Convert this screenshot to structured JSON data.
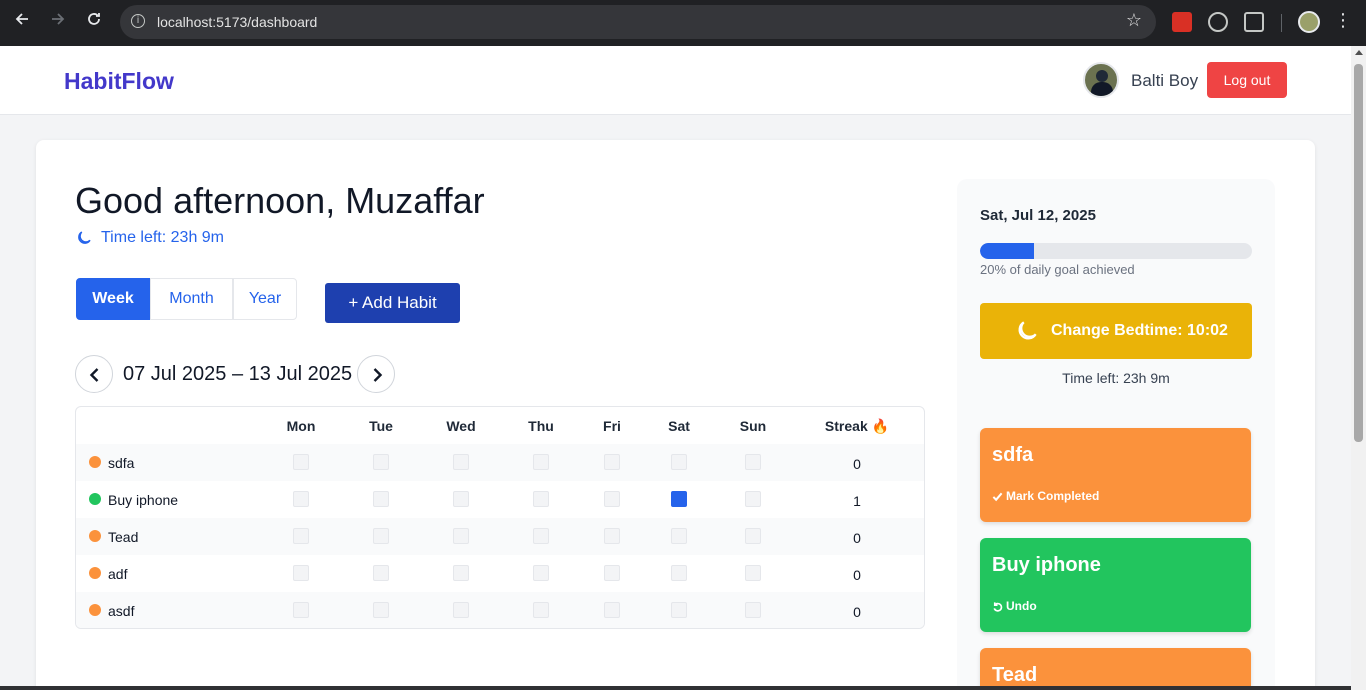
{
  "browser": {
    "url": "localhost:5173/dashboard",
    "info_glyph": "i",
    "star_glyph": "☆",
    "menu_glyph": "⋮"
  },
  "header": {
    "brand": "HabitFlow",
    "user_name": "Balti Boy",
    "logout_label": "Log out"
  },
  "main": {
    "greeting": "Good afternoon, Muzaffar",
    "time_left": "Time left: 23h 9m",
    "view_tabs": [
      {
        "label": "Week",
        "active": true
      },
      {
        "label": "Month",
        "active": false
      },
      {
        "label": "Year",
        "active": false
      }
    ],
    "add_habit_label": "+ Add Habit",
    "date_range": "07 Jul 2025 – 13 Jul 2025",
    "table": {
      "headers": [
        "Mon",
        "Tue",
        "Wed",
        "Thu",
        "Fri",
        "Sat",
        "Sun",
        "Streak 🔥"
      ],
      "rows": [
        {
          "name": "sdfa",
          "color": "#fb923c",
          "days": [
            false,
            false,
            false,
            false,
            false,
            false,
            false
          ],
          "streak": "0"
        },
        {
          "name": "Buy iphone",
          "color": "#22c55e",
          "days": [
            false,
            false,
            false,
            false,
            false,
            true,
            false
          ],
          "streak": "1"
        },
        {
          "name": "Tead",
          "color": "#fb923c",
          "days": [
            false,
            false,
            false,
            false,
            false,
            false,
            false
          ],
          "streak": "0"
        },
        {
          "name": "adf",
          "color": "#fb923c",
          "days": [
            false,
            false,
            false,
            false,
            false,
            false,
            false
          ],
          "streak": "0"
        },
        {
          "name": "asdf",
          "color": "#fb923c",
          "days": [
            false,
            false,
            false,
            false,
            false,
            false,
            false
          ],
          "streak": "0"
        }
      ]
    }
  },
  "side": {
    "date": "Sat, Jul 12, 2025",
    "progress_fraction": 0.2,
    "progress_text": "20% of daily goal achieved",
    "bedtime_label": "Change Bedtime: 10:02",
    "time_left": "Time left: 23h 9m",
    "cards": [
      {
        "title": "sdfa",
        "action": "Mark Completed",
        "color": "#fb923c",
        "icon": "check-icon"
      },
      {
        "title": "Buy iphone",
        "action": "Undo",
        "color": "#22c55e",
        "icon": "undo-icon"
      },
      {
        "title": "Tead",
        "action": "",
        "color": "#fb923c",
        "icon": ""
      }
    ]
  },
  "colors": {
    "brand": "#4338ca",
    "primary": "#2563eb",
    "danger": "#ef4444",
    "bedtime": "#eab308"
  }
}
